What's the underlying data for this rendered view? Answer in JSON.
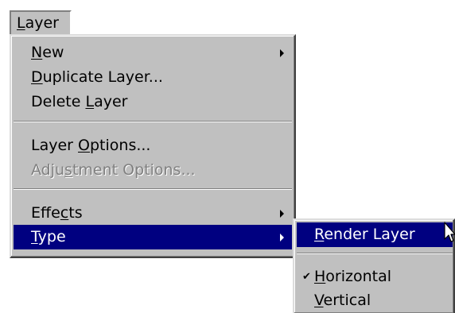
{
  "menubar": {
    "title_accel": "L",
    "title_rest": "ayer"
  },
  "layer_menu": {
    "new": {
      "accel": "N",
      "rest": "ew"
    },
    "duplicate": {
      "accel": "D",
      "rest": "uplicate Layer..."
    },
    "delete": {
      "before": "Delete ",
      "accel": "L",
      "rest": "ayer"
    },
    "layer_options": {
      "before": "Layer ",
      "accel": "O",
      "rest": "ptions..."
    },
    "adjustment_options": {
      "before": "Adju",
      "accel": "s",
      "rest": "tment Options..."
    },
    "effects": {
      "before": "Effe",
      "accel": "c",
      "rest": "ts"
    },
    "type": {
      "accel": "T",
      "rest": "ype"
    }
  },
  "type_submenu": {
    "render_layer": {
      "accel": "R",
      "rest": "ender Layer"
    },
    "horizontal": {
      "accel": "H",
      "rest": "orizontal",
      "checked": true,
      "check_glyph": "✔"
    },
    "vertical": {
      "accel": "V",
      "rest": "ertical"
    }
  },
  "colors": {
    "menu_bg": "#c0c0c0",
    "highlight": "#000080",
    "disabled_text": "#808080"
  }
}
